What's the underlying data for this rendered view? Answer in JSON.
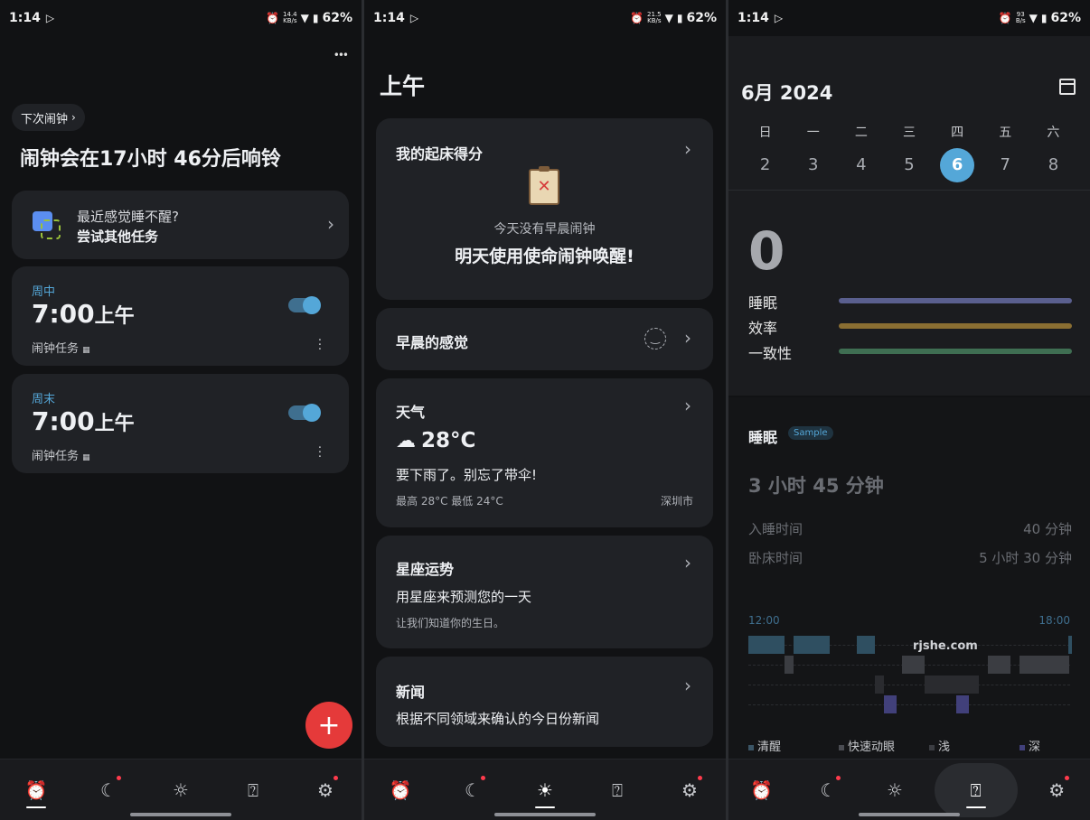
{
  "status_bars": [
    {
      "time": "1:14",
      "net_top": "14.4",
      "net_bottom": "KB/s",
      "battery": "62%"
    },
    {
      "time": "1:14",
      "net_top": "21.5",
      "net_bottom": "KB/s",
      "battery": "62%"
    },
    {
      "time": "1:14",
      "net_top": "93",
      "net_bottom": "B/s",
      "battery": "62%"
    }
  ],
  "alarm": {
    "menu_glyph": "•••",
    "next_alarm_chip": "下次闹钟",
    "headline": "闹钟会在17小时 46分后响铃",
    "promo": {
      "line1": "最近感觉睡不醒?",
      "line2": "尝试其他任务"
    },
    "alarms": [
      {
        "label": "周中",
        "time": "7:00",
        "ampm": "上午",
        "mission": "闹钟任务",
        "on": true
      },
      {
        "label": "周末",
        "time": "7:00",
        "ampm": "上午",
        "mission": "闹钟任务",
        "on": true
      }
    ],
    "fab": "+"
  },
  "morning": {
    "title": "上午",
    "score_card": {
      "title": "我的起床得分",
      "sub": "今天没有早晨闹钟",
      "cta": "明天使用使命闹钟唤醒!"
    },
    "feeling_card": {
      "title": "早晨的感觉"
    },
    "weather_card": {
      "title": "天气",
      "temp": "28°C",
      "advice": "要下雨了。别忘了带伞!",
      "range": "最高 28°C 最低 24°C",
      "city": "深圳市"
    },
    "horoscope_card": {
      "title": "星座运势",
      "line": "用星座来预测您的一天",
      "sub": "让我们知道你的生日。"
    },
    "news_card": {
      "title": "新闻",
      "line": "根据不同领域来确认的今日份新闻"
    }
  },
  "sleep": {
    "month": "6月 2024",
    "weekdays": [
      "日",
      "一",
      "二",
      "三",
      "四",
      "五",
      "六"
    ],
    "dates": [
      "2",
      "3",
      "4",
      "5",
      "6",
      "7",
      "8"
    ],
    "selected_date": "6",
    "score": "0",
    "metrics": [
      {
        "label": "睡眠",
        "color": "#5a5f8e"
      },
      {
        "label": "效率",
        "color": "#8a6e32"
      },
      {
        "label": "一致性",
        "color": "#3f6e52"
      }
    ],
    "section_title": "睡眠",
    "sample_badge": "Sample",
    "duration": "3 小时 45 分钟",
    "rows": [
      {
        "label": "入睡时间",
        "value": "40 分钟"
      },
      {
        "label": "卧床时间",
        "value": "5 小时 30 分钟"
      }
    ],
    "chart_start": "12:00",
    "chart_end": "18:00",
    "watermark": "rjshe.com",
    "legend": [
      "清醒",
      "快速动眼",
      "浅",
      "深"
    ]
  },
  "colors": {
    "accent": "#54a7d8",
    "fab": "#e53a3a",
    "badge_dot": "#ff3b4c"
  }
}
